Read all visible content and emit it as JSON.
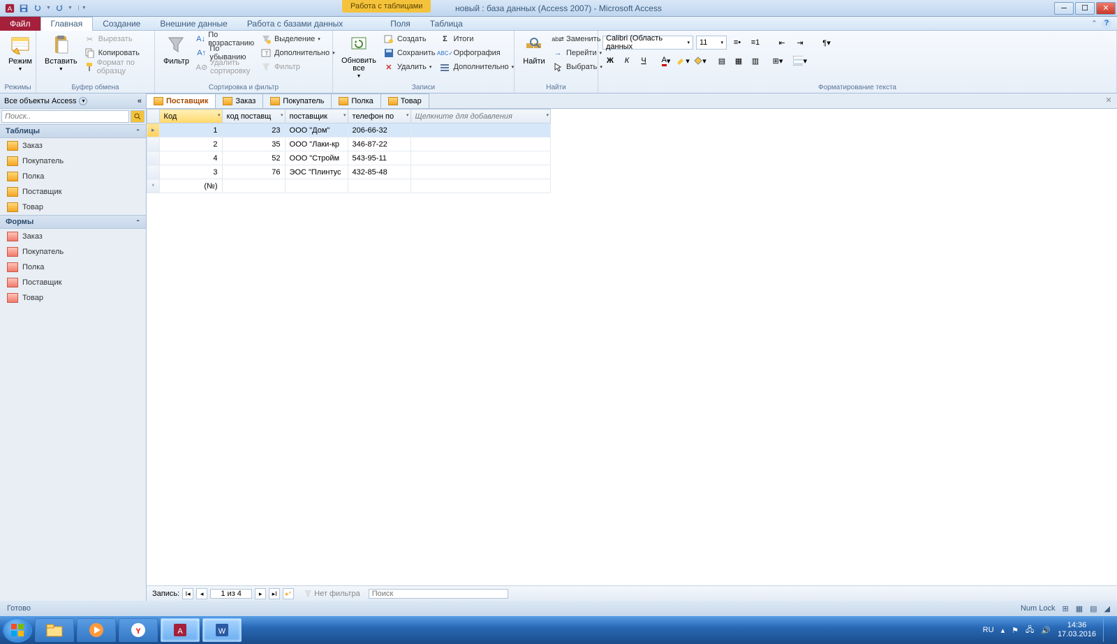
{
  "title": "новый : база данных (Access 2007)  -  Microsoft Access",
  "context_tab": "Работа с таблицами",
  "menu": {
    "file": "Файл",
    "home": "Главная",
    "create": "Создание",
    "external": "Внешние данные",
    "dbtools": "Работа с базами данных",
    "fields": "Поля",
    "table": "Таблица"
  },
  "ribbon": {
    "views": {
      "btn": "Режим",
      "grp": "Режимы"
    },
    "clipboard": {
      "paste": "Вставить",
      "cut": "Вырезать",
      "copy": "Копировать",
      "brush": "Формат по образцу",
      "grp": "Буфер обмена"
    },
    "sort": {
      "filter": "Фильтр",
      "asc": "По возрастанию",
      "desc": "По убыванию",
      "clear": "Удалить сортировку",
      "selection": "Выделение",
      "advanced": "Дополнительно",
      "toggle": "Фильтр",
      "grp": "Сортировка и фильтр"
    },
    "records": {
      "refresh": "Обновить все",
      "new": "Создать",
      "save": "Сохранить",
      "delete": "Удалить",
      "totals": "Итоги",
      "spell": "Орфография",
      "more": "Дополнительно",
      "grp": "Записи"
    },
    "find": {
      "find": "Найти",
      "replace": "Заменить",
      "goto": "Перейти",
      "select": "Выбрать",
      "grp": "Найти"
    },
    "text": {
      "font": "Calibri (Область данных",
      "size": "11",
      "grp": "Форматирование текста"
    }
  },
  "nav": {
    "header": "Все объекты Access",
    "search_ph": "Поиск..",
    "cat_tables": "Таблицы",
    "cat_forms": "Формы",
    "tables": [
      "Заказ",
      "Покупатель",
      "Полка",
      "Поставщик",
      "Товар"
    ],
    "forms": [
      "Заказ",
      "Покупатель",
      "Полка",
      "Поставщик",
      "Товар"
    ]
  },
  "tabs": [
    "Поставщик",
    "Заказ",
    "Покупатель",
    "Полка",
    "Товар"
  ],
  "grid": {
    "cols": [
      "Код",
      "код поставщ",
      "поставщик",
      "телефон по"
    ],
    "add": "Щелкните для добавления",
    "rows": [
      {
        "id": "1",
        "code": "23",
        "name": "ООО \"Дом\"",
        "phone": "206-66-32"
      },
      {
        "id": "2",
        "code": "35",
        "name": "ООО \"Лаки-кр",
        "phone": "346-87-22"
      },
      {
        "id": "4",
        "code": "52",
        "name": "ООО \"Стройм",
        "phone": "543-95-11"
      },
      {
        "id": "3",
        "code": "76",
        "name": "ЭОС \"Плинтус",
        "phone": "432-85-48"
      }
    ],
    "newrow": "(№)"
  },
  "recordbar": {
    "label": "Запись:",
    "pos": "1 из 4",
    "nofilter": "Нет фильтра",
    "search": "Поиск"
  },
  "status": {
    "ready": "Готово",
    "numlock": "Num Lock"
  },
  "tray": {
    "lang": "RU",
    "time": "14:36",
    "date": "17.03.2016"
  }
}
